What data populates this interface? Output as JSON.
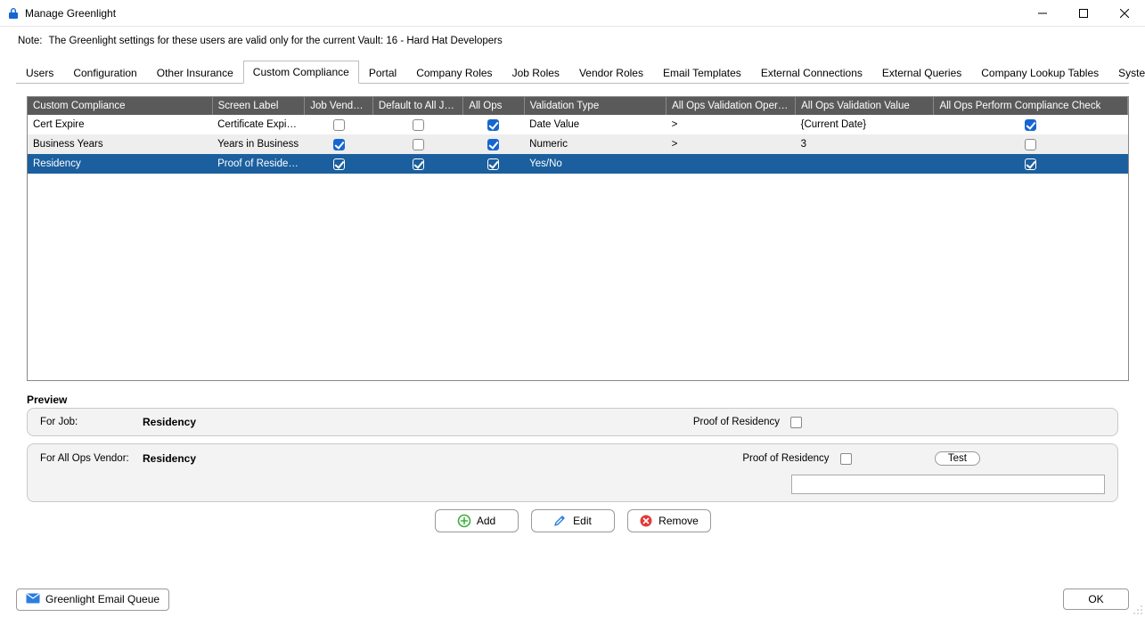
{
  "window": {
    "title": "Manage Greenlight"
  },
  "note": {
    "label": "Note:",
    "text": "The Greenlight settings for these users are valid only for the current Vault: 16 - Hard Hat Developers"
  },
  "tabs": [
    {
      "label": "Users"
    },
    {
      "label": "Configuration"
    },
    {
      "label": "Other Insurance"
    },
    {
      "label": "Custom Compliance"
    },
    {
      "label": "Portal"
    },
    {
      "label": "Company Roles"
    },
    {
      "label": "Job Roles"
    },
    {
      "label": "Vendor Roles"
    },
    {
      "label": "Email Templates"
    },
    {
      "label": "External Connections"
    },
    {
      "label": "External Queries"
    },
    {
      "label": "Company Lookup Tables"
    },
    {
      "label": "System Lookup Tables"
    }
  ],
  "active_tab": "Custom Compliance",
  "grid": {
    "columns": [
      "Custom Compliance",
      "Screen Label",
      "Job Vendors",
      "Default to All Jobs",
      "All Ops",
      "Validation Type",
      "All Ops Validation Operator",
      "All Ops Validation Value",
      "All Ops Perform Compliance Check"
    ],
    "rows": [
      {
        "name": "Cert Expire",
        "screen_label": "Certificate Expirati...",
        "job_vendors": false,
        "default_all_jobs": false,
        "all_ops": true,
        "validation_type": "Date Value",
        "operator": ">",
        "value": "{Current Date}",
        "perform_check": true,
        "selected": false
      },
      {
        "name": "Business Years",
        "screen_label": "Years in Business",
        "job_vendors": true,
        "default_all_jobs": false,
        "all_ops": true,
        "validation_type": "Numeric",
        "operator": ">",
        "value": "3",
        "perform_check": false,
        "selected": false
      },
      {
        "name": "Residency",
        "screen_label": "Proof of Residency",
        "job_vendors": true,
        "default_all_jobs": true,
        "all_ops": true,
        "validation_type": "Yes/No",
        "operator": "",
        "value": "",
        "perform_check": true,
        "selected": true
      }
    ]
  },
  "preview": {
    "heading": "Preview",
    "job_label": "For Job:",
    "job_name": "Residency",
    "job_field_label": "Proof of Residency",
    "job_field_checked": false,
    "vendor_label": "For All Ops Vendor:",
    "vendor_name": "Residency",
    "vendor_field_label": "Proof of Residency",
    "vendor_field_checked": false,
    "test_button": "Test",
    "vendor_text_value": ""
  },
  "actions": {
    "add": "Add",
    "edit": "Edit",
    "remove": "Remove"
  },
  "footer": {
    "queue_button": "Greenlight Email Queue",
    "ok_button": "OK"
  }
}
